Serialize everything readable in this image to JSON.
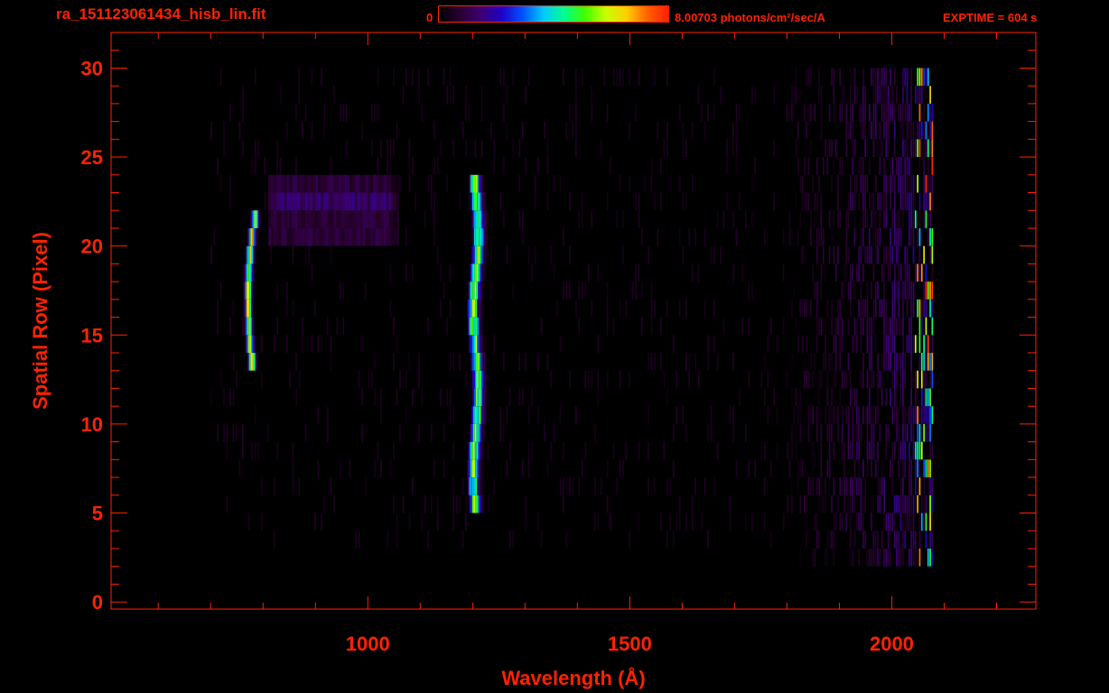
{
  "header": {
    "title": "ra_151123061434_hisb_lin.fit",
    "colorbar_min": "0",
    "colorbar_max": "8.00703 photons/cm²/sec/A",
    "exptime": "EXPTIME = 604 s"
  },
  "colors": {
    "axis": "#ff2200",
    "background": "#000000",
    "colormap": [
      "#000000",
      "#2a0030",
      "#3c0070",
      "#2000c8",
      "#0050ff",
      "#00c8ff",
      "#00ff90",
      "#40ff00",
      "#c8ff00",
      "#ffd000",
      "#ff6000",
      "#ff2000"
    ]
  },
  "chart_data": {
    "type": "heatmap",
    "title": "ra_151123061434_hisb_lin.fit",
    "xlabel": "Wavelength (Å)",
    "ylabel": "Spatial Row (Pixel)",
    "xlim": [
      510,
      2275
    ],
    "ylim": [
      -0.4,
      32
    ],
    "xticks": [
      1000,
      1500,
      2000
    ],
    "yticks": [
      0,
      5,
      10,
      15,
      20,
      25,
      30
    ],
    "colorbar": {
      "min": 0,
      "max": 8.00703,
      "units": "photons/cm²/sec/A"
    },
    "features": [
      {
        "label": "curved emission band",
        "x_range": [
          755,
          810
        ],
        "rows": [
          13,
          22
        ],
        "peak_intensity": 7.5
      },
      {
        "label": "diffuse band",
        "x_range": [
          810,
          1060
        ],
        "rows": [
          20,
          24
        ],
        "peak_intensity": 1.8
      },
      {
        "label": "bright vertical line",
        "x_range": [
          1190,
          1240
        ],
        "rows": [
          5,
          24
        ],
        "peak_intensity": 6.5
      },
      {
        "label": "noisy continuum edge",
        "x_range": [
          1800,
          2080
        ],
        "rows": [
          2,
          30
        ],
        "peak_intensity": 8.0
      }
    ]
  }
}
